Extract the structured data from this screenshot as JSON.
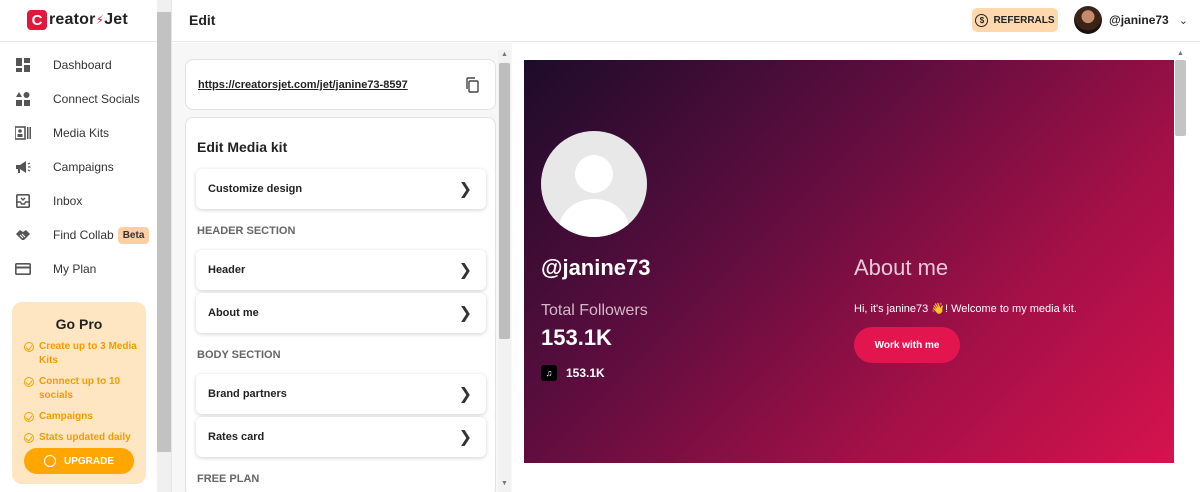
{
  "brand": {
    "logo_letter": "C",
    "name_part1": "reator",
    "name_part2": "Jet",
    "bolt": "⚡"
  },
  "sidebar": {
    "items": [
      {
        "label": "Dashboard",
        "icon": "dashboard-icon"
      },
      {
        "label": "Connect Socials",
        "icon": "shapes-icon"
      },
      {
        "label": "Media Kits",
        "icon": "media-kit-icon"
      },
      {
        "label": "Campaigns",
        "icon": "megaphone-icon"
      },
      {
        "label": "Inbox",
        "icon": "inbox-icon"
      },
      {
        "label": "Find Collab",
        "icon": "handshake-icon",
        "badge": "Beta"
      },
      {
        "label": "My Plan",
        "icon": "card-icon"
      }
    ],
    "gopro": {
      "title": "Go Pro",
      "features": [
        "Create up to 3 Media Kits",
        "Connect up to 10 socials",
        "Campaigns",
        "Stats updated daily"
      ],
      "upgrade_label": "UPGRADE"
    }
  },
  "header": {
    "title": "Edit",
    "referrals_label": "REFERRALS",
    "username": "@janine73"
  },
  "editor": {
    "url": "https://creatorsjet.com/jet/janine73-8597",
    "heading": "Edit Media kit",
    "customize_label": "Customize design",
    "header_section": "HEADER SECTION",
    "header_label": "Header",
    "about_label": "About me",
    "body_section": "BODY SECTION",
    "brand_partners_label": "Brand partners",
    "rates_label": "Rates card",
    "free_plan": "FREE PLAN"
  },
  "preview": {
    "handle": "@janine73",
    "followers_label": "Total Followers",
    "followers_value": "153.1K",
    "tiktok_value": "153.1K",
    "about_title": "About me",
    "bio": "Hi, it's janine73 👋! Welcome to my media kit.",
    "cta_label": "Work with me"
  },
  "colors": {
    "brand_red": "#e3163c",
    "accent_orange": "#ffa600",
    "referral_bg": "#ffd9ad"
  }
}
